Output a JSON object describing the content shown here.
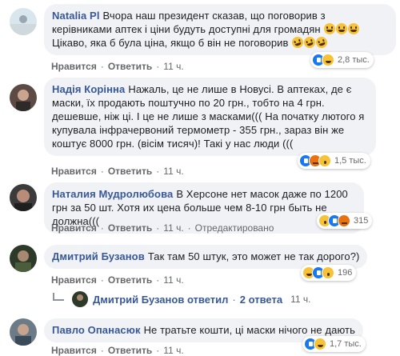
{
  "comments": [
    {
      "author": "Natalia Pl",
      "text": "Вчора наш президент сказав, що поговорив з керівниками аптек і ціни будуть доступні для громадян",
      "text2": "Цікаво, яка б була ціна, якщо б він не поговорив",
      "like": "Нравится",
      "reply": "Ответить",
      "age": "11 ч.",
      "reactions": "2,8 тыс."
    },
    {
      "author": "Надія Корінна",
      "text": "Нажаль, це не лише в Новусі. В аптеках, де є маски, їх продають поштучно по 20 грн., тобто на 4 грн. дешевше, ніж ці. І це не лише з масками((( На початку лютого я купувала інфрачервоний термометр - 355 грн., зараз він же коштує 8000 грн. (вісім тисяч)! Такі у нас люди (((",
      "like": "Нравится",
      "reply": "Ответить",
      "age": "11 ч.",
      "reactions": "1,5 тыс."
    },
    {
      "author": "Наталия Мудролюбова",
      "text": "В Херсоне нет масок даже по 1200 грн за 50 шт. Хотя их цена больше чем 8-10 грн быть не должна(((",
      "like": "Нравится",
      "reply": "Ответить",
      "age": "11 ч.",
      "edited": "Отредактировано",
      "reactions": "315"
    },
    {
      "author": "Дмитрий Бузанов",
      "text": "Так там 50 штук, это может не так дорого?)",
      "like": "Нравится",
      "reply": "Ответить",
      "age": "11 ч.",
      "reactions": "196"
    },
    {
      "author": "Павло Опанасюк",
      "text": "Не тратьте кошти, ці маски нічого не дають",
      "like": "Нравится",
      "reply": "Ответить",
      "age": "11 ч.",
      "reactions": "1,7 тыс."
    }
  ],
  "reply_thread": {
    "who": "Дмитрий Бузанов",
    "verb": "ответил",
    "count": "2 ответа",
    "age": "11 ч."
  },
  "colors": {
    "bubble": "#f0f2f5",
    "author": "#385898",
    "meta": "#65676b"
  }
}
